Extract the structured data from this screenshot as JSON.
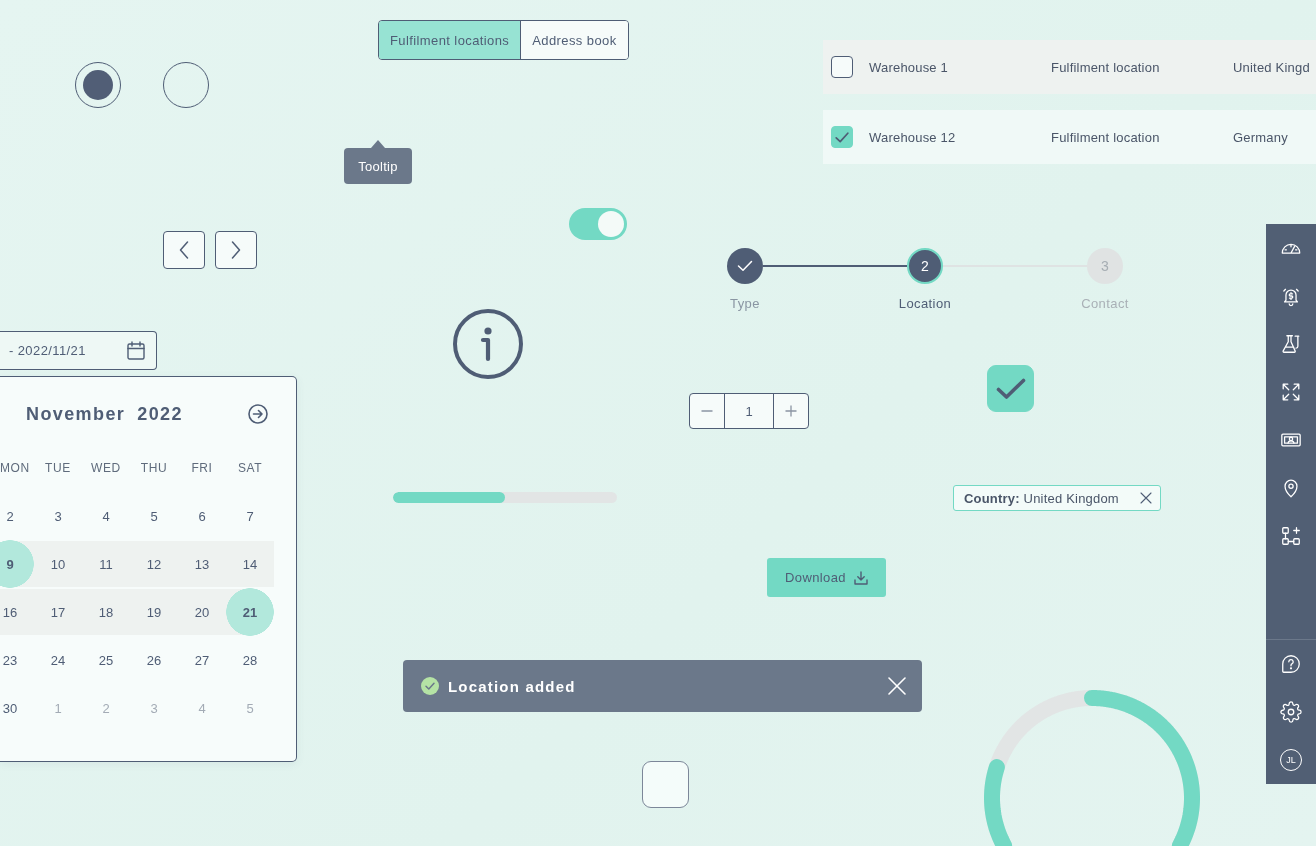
{
  "radio_buttons": [
    {
      "selected": true
    },
    {
      "selected": false
    }
  ],
  "segmented_control": [
    {
      "label": "Fulfilment locations",
      "selected": true
    },
    {
      "label": "Address book",
      "selected": false
    }
  ],
  "table": {
    "rows": [
      {
        "checked": false,
        "cells": [
          "Warehouse 1",
          "Fulfilment location",
          "United Kingd"
        ]
      },
      {
        "checked": true,
        "cells": [
          "Warehouse 12",
          "Fulfilment location",
          "Germany"
        ]
      }
    ]
  },
  "tooltip": {
    "text": "Tooltip"
  },
  "toggle": {
    "on": true
  },
  "stepper": [
    {
      "label": "Type",
      "completed": true,
      "selected": false
    },
    {
      "number": "2",
      "label": "Location",
      "completed": false,
      "selected": true
    },
    {
      "number": "3",
      "label": "Contact",
      "completed": false,
      "selected": false
    }
  ],
  "date_range_field": {
    "value": "- 2022/11/21"
  },
  "calendar": {
    "month": "November",
    "year": "2022",
    "weekdays": [
      "MON",
      "TUE",
      "WED",
      "THU",
      "FRI",
      "SAT"
    ],
    "weeks": [
      [
        {
          "day": "2",
          "selected": false,
          "outside_month": false
        },
        {
          "day": "3",
          "selected": false,
          "outside_month": false
        },
        {
          "day": "4",
          "selected": false,
          "outside_month": false
        },
        {
          "day": "5",
          "selected": false,
          "outside_month": false
        },
        {
          "day": "6",
          "selected": false,
          "outside_month": false
        },
        {
          "day": "7",
          "selected": false,
          "outside_month": false
        }
      ],
      [
        {
          "day": "9",
          "selected": true,
          "outside_month": false
        },
        {
          "day": "10",
          "selected": false,
          "outside_month": false
        },
        {
          "day": "11",
          "selected": false,
          "outside_month": false
        },
        {
          "day": "12",
          "selected": false,
          "outside_month": false
        },
        {
          "day": "13",
          "selected": false,
          "outside_month": false
        },
        {
          "day": "14",
          "selected": false,
          "outside_month": false
        }
      ],
      [
        {
          "day": "16",
          "selected": false,
          "outside_month": false
        },
        {
          "day": "17",
          "selected": false,
          "outside_month": false
        },
        {
          "day": "18",
          "selected": false,
          "outside_month": false
        },
        {
          "day": "19",
          "selected": false,
          "outside_month": false
        },
        {
          "day": "20",
          "selected": false,
          "outside_month": false
        },
        {
          "day": "21",
          "selected": true,
          "outside_month": false
        }
      ],
      [
        {
          "day": "23",
          "selected": false,
          "outside_month": false
        },
        {
          "day": "24",
          "selected": false,
          "outside_month": false
        },
        {
          "day": "25",
          "selected": false,
          "outside_month": false
        },
        {
          "day": "26",
          "selected": false,
          "outside_month": false
        },
        {
          "day": "27",
          "selected": false,
          "outside_month": false
        },
        {
          "day": "28",
          "selected": false,
          "outside_month": false
        }
      ],
      [
        {
          "day": "30",
          "selected": false,
          "outside_month": false
        },
        {
          "day": "1",
          "selected": false,
          "outside_month": true
        },
        {
          "day": "2",
          "selected": false,
          "outside_month": true
        },
        {
          "day": "3",
          "selected": false,
          "outside_month": true
        },
        {
          "day": "4",
          "selected": false,
          "outside_month": true
        },
        {
          "day": "5",
          "selected": false,
          "outside_month": true
        }
      ]
    ]
  },
  "quantity_stepper": {
    "value": "1"
  },
  "large_checkboxes": [
    {
      "checked": true
    },
    {
      "checked": false
    }
  ],
  "progress_bar": {
    "level": 0.5
  },
  "filter_chip": {
    "text": "**Country:** United Kingdom"
  },
  "download_button": {
    "label": "Download"
  },
  "toast": {
    "message": "Location added"
  },
  "progress_ring": {
    "level": 0.8
  },
  "sidebar": {
    "avatar_initials": "JL"
  }
}
